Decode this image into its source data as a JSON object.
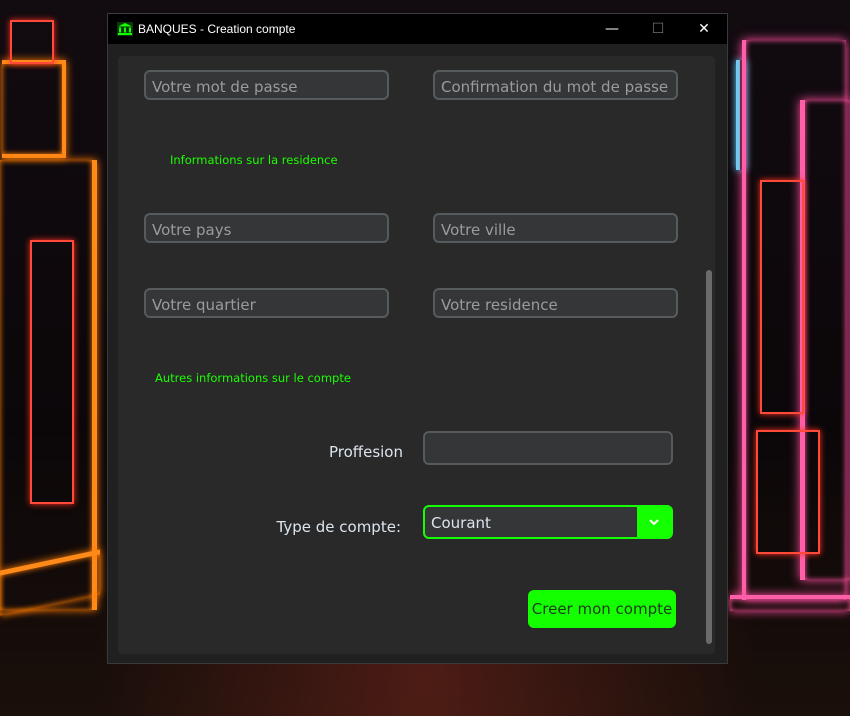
{
  "window": {
    "title": "BANQUES - Creation compte",
    "controls": {
      "minimize": "—",
      "maximize": "☐",
      "close": "✕"
    }
  },
  "form": {
    "password_placeholder": "Votre mot de passe",
    "password_confirm_placeholder": "Confirmation du mot de passe",
    "residence_section": "Informations sur la residence",
    "country_placeholder": "Votre pays",
    "city_placeholder": "Votre ville",
    "district_placeholder": "Votre quartier",
    "residence_placeholder": "Votre residence",
    "account_section": "Autres informations sur le compte",
    "profession_label": "Proffesion",
    "profession_value": "",
    "account_type_label": "Type de compte:",
    "account_type_value": "Courant",
    "submit_label": "Creer mon compte"
  },
  "colors": {
    "accent": "#14ff00",
    "field_bg": "#343638",
    "field_border": "#565b5e",
    "window_bg": "#292929"
  },
  "icons": {
    "app": "bank-icon",
    "dropdown": "chevron-down-icon"
  }
}
